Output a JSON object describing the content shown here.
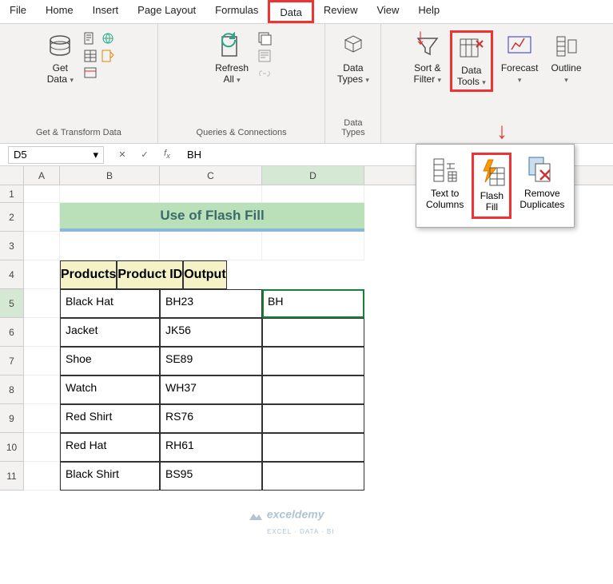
{
  "tabs": [
    "File",
    "Home",
    "Insert",
    "Page Layout",
    "Formulas",
    "Data",
    "Review",
    "View",
    "Help"
  ],
  "active_tab": "Data",
  "ribbon": {
    "groups": [
      {
        "label": "Get & Transform Data",
        "items": [
          {
            "label": "Get\nData"
          }
        ]
      },
      {
        "label": "Queries & Connections",
        "items": [
          {
            "label": "Refresh\nAll"
          }
        ]
      },
      {
        "label": "Data Types",
        "items": [
          {
            "label": "Data\nTypes"
          }
        ]
      },
      {
        "label": "",
        "items": [
          {
            "label": "Sort &\nFilter"
          },
          {
            "label": "Data\nTools"
          },
          {
            "label": "Forecast"
          },
          {
            "label": "Outline"
          }
        ]
      }
    ]
  },
  "name_box": "D5",
  "fx_value": "BH",
  "columns": [
    "A",
    "B",
    "C",
    "D"
  ],
  "rows": [
    "1",
    "2",
    "3",
    "4",
    "5",
    "6",
    "7",
    "8",
    "9",
    "10",
    "11"
  ],
  "title": "Use of Flash Fill",
  "headers": [
    "Products",
    "Product ID",
    "Output"
  ],
  "data": [
    {
      "product": "Black Hat",
      "id": "BH23",
      "output": "BH"
    },
    {
      "product": "Jacket",
      "id": "JK56",
      "output": ""
    },
    {
      "product": "Shoe",
      "id": "SE89",
      "output": ""
    },
    {
      "product": "Watch",
      "id": "WH37",
      "output": ""
    },
    {
      "product": "Red Shirt",
      "id": "RS76",
      "output": ""
    },
    {
      "product": "Red Hat",
      "id": "RH61",
      "output": ""
    },
    {
      "product": "Black Shirt",
      "id": "BS95",
      "output": ""
    }
  ],
  "dropdown": {
    "items": [
      {
        "label": "Text to\nColumns"
      },
      {
        "label": "Flash\nFill"
      },
      {
        "label": "Remove\nDuplicates"
      }
    ]
  },
  "watermark": {
    "main": "exceldemy",
    "sub": "EXCEL · DATA · BI"
  }
}
